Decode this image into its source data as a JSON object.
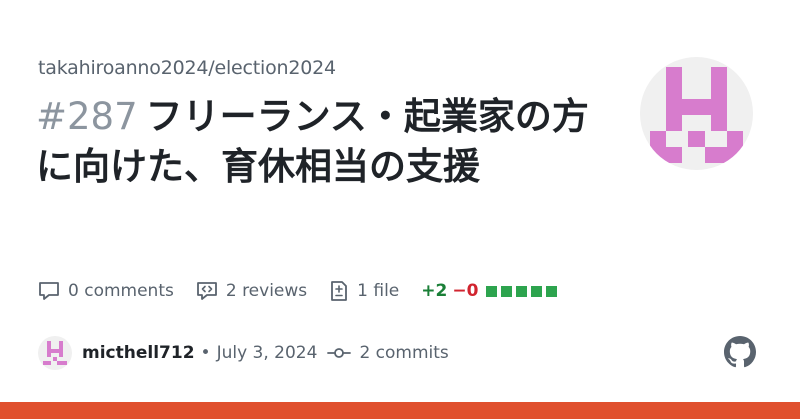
{
  "repo": "takahiroanno2024/election2024",
  "pr": {
    "number": "#287",
    "title": "フリーランス・起業家の方に向けた、育休相当の支援"
  },
  "stats": {
    "comments": "0 comments",
    "reviews": "2 reviews",
    "files": "1 file",
    "additions": "+2",
    "deletions": "−0",
    "diff_blocks": [
      "added",
      "added",
      "added",
      "added",
      "added"
    ]
  },
  "meta": {
    "author": "micthell712",
    "date_sep": "•",
    "date": "July 3, 2024",
    "commits": "2 commits"
  },
  "colors": {
    "accent_pink": "#d77ccd",
    "add_green": "#1a7f37",
    "del_red": "#d1242f",
    "block_green": "#2da44e",
    "footer_bar": "#e0502e"
  },
  "icons": [
    "comment-icon",
    "review-icon",
    "file-diff-icon",
    "commit-icon",
    "github-icon"
  ]
}
